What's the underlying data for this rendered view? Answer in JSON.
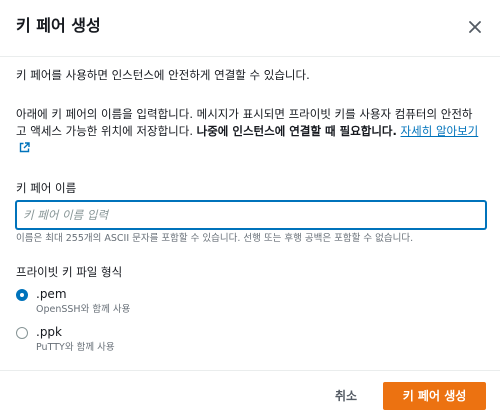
{
  "modal": {
    "title": "키 페어 생성"
  },
  "description": {
    "line1": "키 페어를 사용하면 인스턴스에 안전하게 연결할 수 있습니다.",
    "line2_plain": "아래에 키 페어의 이름을 입력합니다. 메시지가 표시되면 프라이빗 키를 사용자 컴퓨터의 안전하고 액세스 가능한 위치에 저장합니다. ",
    "line2_bold": "나중에 인스턴스에 연결할 때 필요합니다.",
    "learn_more_link": "자세히 알아보기"
  },
  "key_name": {
    "label": "키 페어 이름",
    "value": "",
    "placeholder": "키 페어 이름 입력",
    "hint": "이름은 최대 255개의 ASCII 문자를 포함할 수 있습니다. 선행 또는 후행 공백은 포함할 수 없습니다."
  },
  "file_format": {
    "label": "프라이빗 키 파일 형식",
    "options": [
      {
        "title": ".pem",
        "desc": "OpenSSH와 함께 사용",
        "selected": true
      },
      {
        "title": ".ppk",
        "desc": "PuTTY와 함께 사용",
        "selected": false
      }
    ]
  },
  "footer": {
    "cancel_label": "취소",
    "create_label": "키 페어 생성"
  },
  "colors": {
    "primary": "#ec7211",
    "link": "#0073bb",
    "text": "#16191f",
    "muted": "#687078"
  },
  "icons": {
    "close": "close-icon",
    "external": "external-link-icon"
  }
}
